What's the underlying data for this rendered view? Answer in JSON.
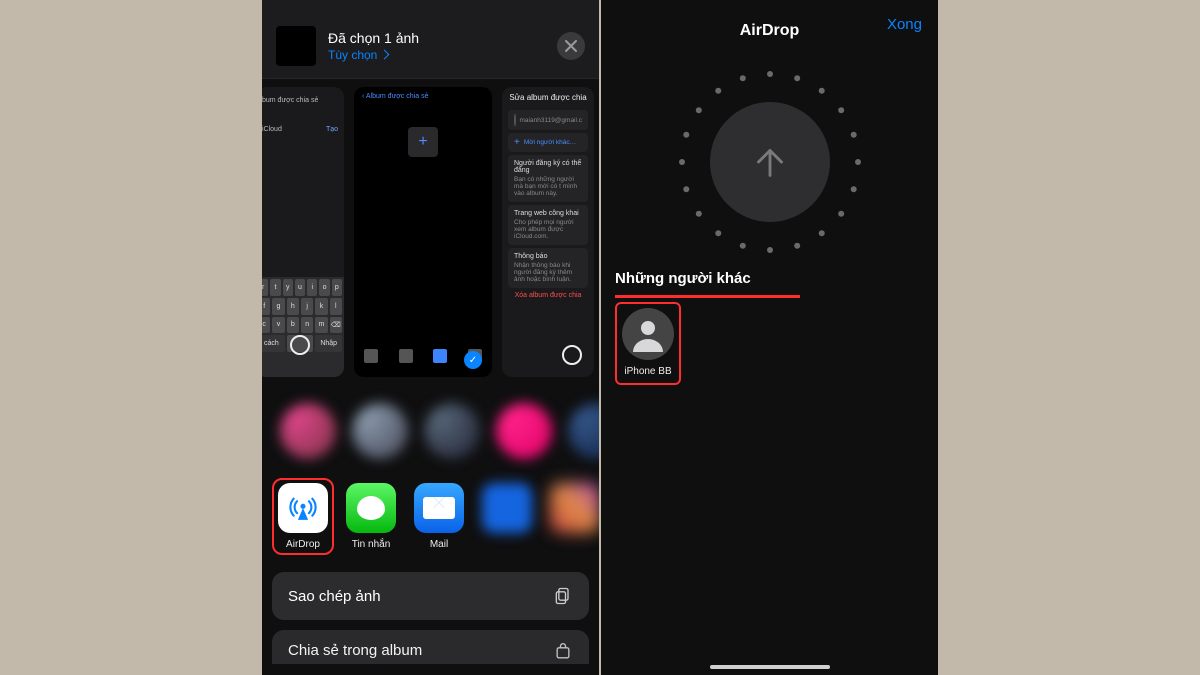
{
  "left": {
    "header": {
      "title": "Đã chọn 1 ảnh",
      "options": "Tùy chọn",
      "close_aria": "Đóng"
    },
    "thumbs": {
      "thumb1": {
        "shared_label": "bum được chia sẻ",
        "icloud": "iCloud",
        "icloud_action": "Tạo"
      },
      "thumb2": {
        "back": "‹ Album được chia sẻ",
        "plus": "+"
      },
      "thumb3": {
        "title": "Sửa album được chia",
        "email": "maianh3119@gmail.c",
        "invite": "Mời người khác…",
        "sec1_hd": "Người đăng ký có thể đăng",
        "sec1_body": "Bạn có những người mà bạn mời có t mình vào album này.",
        "sec2_hd": "Trang web công khai",
        "sec2_body": "Cho phép mọi người xem album được iCloud.com.",
        "sec3_hd": "Thông báo",
        "sec3_body": "Nhận thông báo khi người đăng ký thêm ảnh hoặc bình luận.",
        "delete": "Xóa album được chia"
      }
    },
    "apps": {
      "airdrop": "AirDrop",
      "messages": "Tin nhắn",
      "mail": "Mail"
    },
    "actions": {
      "copy": "Sao chép ảnh",
      "share_in_album": "Chia sẻ trong album"
    },
    "keyboard_rows": [
      [
        "r",
        "t",
        "y",
        "u",
        "i",
        "o",
        "p"
      ],
      [
        "f",
        "g",
        "h",
        "j",
        "k",
        "l"
      ],
      [
        "c",
        "v",
        "b",
        "n",
        "m",
        "⌫"
      ],
      [
        "cách",
        " ",
        "Nhập"
      ]
    ]
  },
  "right": {
    "title": "AirDrop",
    "done": "Xong",
    "section": "Những người khác",
    "device": "iPhone BB"
  }
}
